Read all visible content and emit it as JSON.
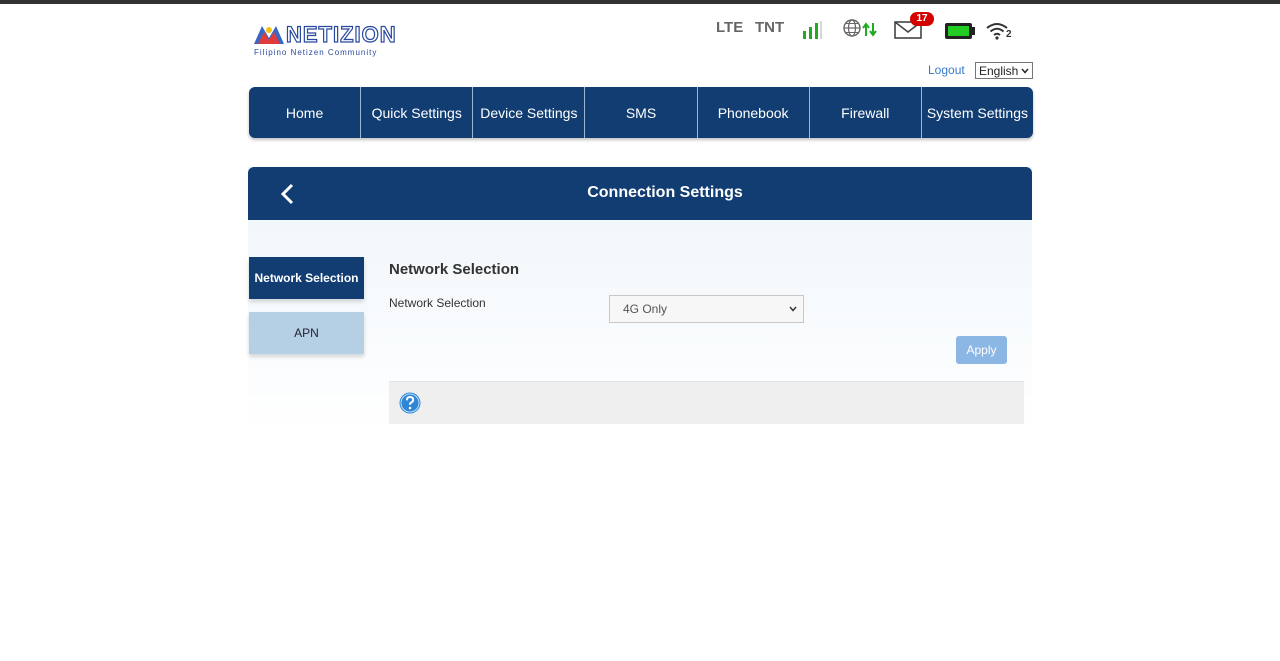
{
  "brand": {
    "name": "NETIZION",
    "tagline": "Filipino Netizen Community"
  },
  "status": {
    "network_type": "LTE",
    "operator": "TNT",
    "signal_icon": "signal-bars-icon",
    "internet_icon": "globe-data-icon",
    "sms_icon": "envelope-icon",
    "sms_unread": "17",
    "battery_icon": "battery-icon",
    "wifi_icon": "wifi-icon",
    "wifi_clients": "2",
    "colors": {
      "signal": "#22aa22",
      "battery": "#22cc22",
      "badge": "#d40000"
    }
  },
  "header": {
    "logout_label": "Logout",
    "language_value": "English"
  },
  "nav": {
    "items": [
      "Home",
      "Quick Settings",
      "Device Settings",
      "SMS",
      "Phonebook",
      "Firewall",
      "System Settings"
    ]
  },
  "page": {
    "title": "Connection Settings",
    "back_icon": "chevron-left-icon"
  },
  "sidebar": {
    "items": [
      {
        "label": "Network Selection",
        "active": true
      },
      {
        "label": "APN",
        "active": false
      }
    ]
  },
  "form": {
    "section_title": "Network Selection",
    "field_label": "Network Selection",
    "network_mode_value": "4G Only",
    "apply_label": "Apply",
    "help_icon": "question-mark-icon"
  },
  "theme": {
    "primary": "#113d73",
    "side_inactive": "#b5cfe4",
    "apply": "#8cb6e3",
    "link": "#3a7bc8"
  }
}
